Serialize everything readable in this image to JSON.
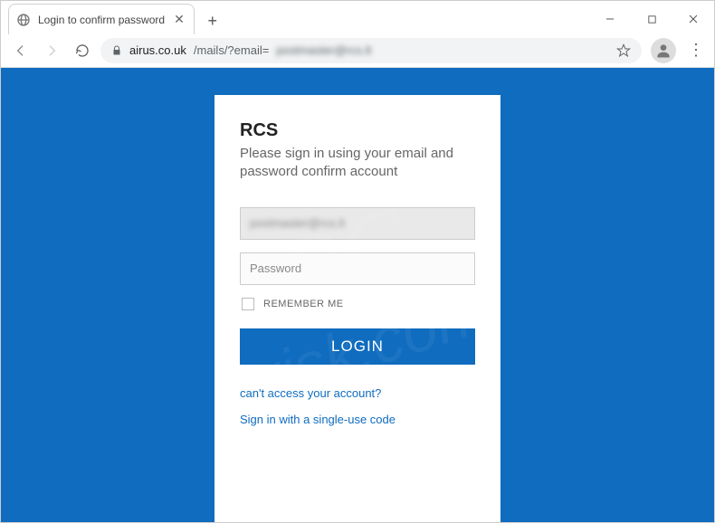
{
  "browser": {
    "tab_title": "Login to confirm password",
    "url_host": "airus.co.uk",
    "url_path": "/mails/?email=",
    "url_query_blurred": "postmaster@rcs.lt"
  },
  "card": {
    "brand": "RCS",
    "subtitle": "Please sign in using your email and password confirm account",
    "email_value": "postmaster@rcs.lt",
    "password_placeholder": "Password",
    "remember_label": "REMEMBER ME",
    "login_label": "LOGIN",
    "link_recover": "can't access your account?",
    "link_single": "Sign in with a single-use code"
  },
  "colors": {
    "accent": "#0f6cbf"
  }
}
